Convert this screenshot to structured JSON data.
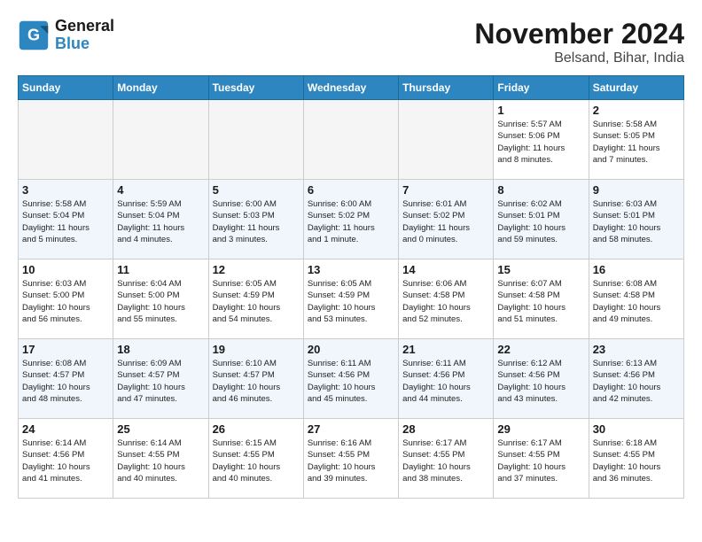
{
  "logo": {
    "line1": "General",
    "line2": "Blue"
  },
  "title": "November 2024",
  "subtitle": "Belsand, Bihar, India",
  "days_of_week": [
    "Sunday",
    "Monday",
    "Tuesday",
    "Wednesday",
    "Thursday",
    "Friday",
    "Saturday"
  ],
  "weeks": [
    [
      {
        "day": "",
        "info": ""
      },
      {
        "day": "",
        "info": ""
      },
      {
        "day": "",
        "info": ""
      },
      {
        "day": "",
        "info": ""
      },
      {
        "day": "",
        "info": ""
      },
      {
        "day": "1",
        "info": "Sunrise: 5:57 AM\nSunset: 5:06 PM\nDaylight: 11 hours\nand 8 minutes."
      },
      {
        "day": "2",
        "info": "Sunrise: 5:58 AM\nSunset: 5:05 PM\nDaylight: 11 hours\nand 7 minutes."
      }
    ],
    [
      {
        "day": "3",
        "info": "Sunrise: 5:58 AM\nSunset: 5:04 PM\nDaylight: 11 hours\nand 5 minutes."
      },
      {
        "day": "4",
        "info": "Sunrise: 5:59 AM\nSunset: 5:04 PM\nDaylight: 11 hours\nand 4 minutes."
      },
      {
        "day": "5",
        "info": "Sunrise: 6:00 AM\nSunset: 5:03 PM\nDaylight: 11 hours\nand 3 minutes."
      },
      {
        "day": "6",
        "info": "Sunrise: 6:00 AM\nSunset: 5:02 PM\nDaylight: 11 hours\nand 1 minute."
      },
      {
        "day": "7",
        "info": "Sunrise: 6:01 AM\nSunset: 5:02 PM\nDaylight: 11 hours\nand 0 minutes."
      },
      {
        "day": "8",
        "info": "Sunrise: 6:02 AM\nSunset: 5:01 PM\nDaylight: 10 hours\nand 59 minutes."
      },
      {
        "day": "9",
        "info": "Sunrise: 6:03 AM\nSunset: 5:01 PM\nDaylight: 10 hours\nand 58 minutes."
      }
    ],
    [
      {
        "day": "10",
        "info": "Sunrise: 6:03 AM\nSunset: 5:00 PM\nDaylight: 10 hours\nand 56 minutes."
      },
      {
        "day": "11",
        "info": "Sunrise: 6:04 AM\nSunset: 5:00 PM\nDaylight: 10 hours\nand 55 minutes."
      },
      {
        "day": "12",
        "info": "Sunrise: 6:05 AM\nSunset: 4:59 PM\nDaylight: 10 hours\nand 54 minutes."
      },
      {
        "day": "13",
        "info": "Sunrise: 6:05 AM\nSunset: 4:59 PM\nDaylight: 10 hours\nand 53 minutes."
      },
      {
        "day": "14",
        "info": "Sunrise: 6:06 AM\nSunset: 4:58 PM\nDaylight: 10 hours\nand 52 minutes."
      },
      {
        "day": "15",
        "info": "Sunrise: 6:07 AM\nSunset: 4:58 PM\nDaylight: 10 hours\nand 51 minutes."
      },
      {
        "day": "16",
        "info": "Sunrise: 6:08 AM\nSunset: 4:58 PM\nDaylight: 10 hours\nand 49 minutes."
      }
    ],
    [
      {
        "day": "17",
        "info": "Sunrise: 6:08 AM\nSunset: 4:57 PM\nDaylight: 10 hours\nand 48 minutes."
      },
      {
        "day": "18",
        "info": "Sunrise: 6:09 AM\nSunset: 4:57 PM\nDaylight: 10 hours\nand 47 minutes."
      },
      {
        "day": "19",
        "info": "Sunrise: 6:10 AM\nSunset: 4:57 PM\nDaylight: 10 hours\nand 46 minutes."
      },
      {
        "day": "20",
        "info": "Sunrise: 6:11 AM\nSunset: 4:56 PM\nDaylight: 10 hours\nand 45 minutes."
      },
      {
        "day": "21",
        "info": "Sunrise: 6:11 AM\nSunset: 4:56 PM\nDaylight: 10 hours\nand 44 minutes."
      },
      {
        "day": "22",
        "info": "Sunrise: 6:12 AM\nSunset: 4:56 PM\nDaylight: 10 hours\nand 43 minutes."
      },
      {
        "day": "23",
        "info": "Sunrise: 6:13 AM\nSunset: 4:56 PM\nDaylight: 10 hours\nand 42 minutes."
      }
    ],
    [
      {
        "day": "24",
        "info": "Sunrise: 6:14 AM\nSunset: 4:56 PM\nDaylight: 10 hours\nand 41 minutes."
      },
      {
        "day": "25",
        "info": "Sunrise: 6:14 AM\nSunset: 4:55 PM\nDaylight: 10 hours\nand 40 minutes."
      },
      {
        "day": "26",
        "info": "Sunrise: 6:15 AM\nSunset: 4:55 PM\nDaylight: 10 hours\nand 40 minutes."
      },
      {
        "day": "27",
        "info": "Sunrise: 6:16 AM\nSunset: 4:55 PM\nDaylight: 10 hours\nand 39 minutes."
      },
      {
        "day": "28",
        "info": "Sunrise: 6:17 AM\nSunset: 4:55 PM\nDaylight: 10 hours\nand 38 minutes."
      },
      {
        "day": "29",
        "info": "Sunrise: 6:17 AM\nSunset: 4:55 PM\nDaylight: 10 hours\nand 37 minutes."
      },
      {
        "day": "30",
        "info": "Sunrise: 6:18 AM\nSunset: 4:55 PM\nDaylight: 10 hours\nand 36 minutes."
      }
    ]
  ]
}
